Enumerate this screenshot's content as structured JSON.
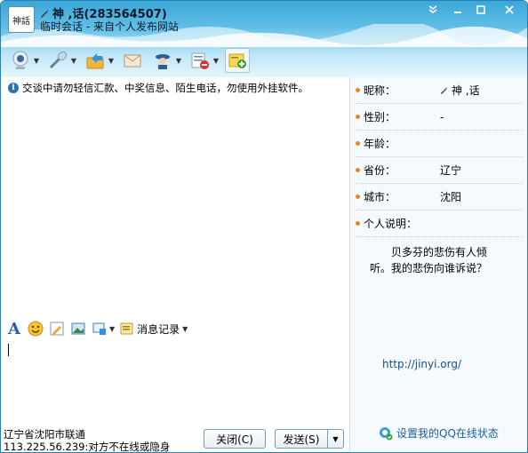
{
  "window": {
    "avatar_text": "神話",
    "contact_name": "神 ,话(283564507)",
    "subtitle": "临时会话 - 来自个人发布网站"
  },
  "toolbar": {
    "items": [
      {
        "icon": "webcam-icon",
        "has_menu": true
      },
      {
        "icon": "microphone-icon",
        "has_menu": true
      },
      {
        "icon": "send-file-icon",
        "has_menu": true
      },
      {
        "icon": "email-icon",
        "has_menu": false
      },
      {
        "icon": "contact-card-icon",
        "has_menu": true
      },
      {
        "icon": "block-icon",
        "has_menu": true
      },
      {
        "icon": "add-friend-icon",
        "has_menu": false
      }
    ]
  },
  "notice": "交谈中请勿轻信汇款、中奖信息、陌生电话，勿使用外挂软件。",
  "format_bar": {
    "history_label": "消息记录"
  },
  "status": {
    "location": "辽宁省沈阳市联通",
    "ip_status": "113.225.56.239:对方不在线或隐身"
  },
  "buttons": {
    "close": "关闭(C)",
    "send": "发送(S)"
  },
  "profile": {
    "rows": [
      {
        "label": "昵称：",
        "value": "神 ,话"
      },
      {
        "label": "性别：",
        "value": "-"
      },
      {
        "label": "年龄：",
        "value": ""
      },
      {
        "label": "省份：",
        "value": "辽宁"
      },
      {
        "label": "城市：",
        "value": "沈阳"
      },
      {
        "label": "个人说明：",
        "value": ""
      }
    ],
    "signature": "贝多芬的悲伤有人倾听。我的悲伤向谁诉说？",
    "homepage": "http://jinyi.org/",
    "qq_status_link": "设置我的QQ在线状态"
  },
  "colors": {
    "title_blue": "#3aa6d8",
    "link_blue": "#1a5fa8",
    "dot_orange": "#e08a2a"
  }
}
